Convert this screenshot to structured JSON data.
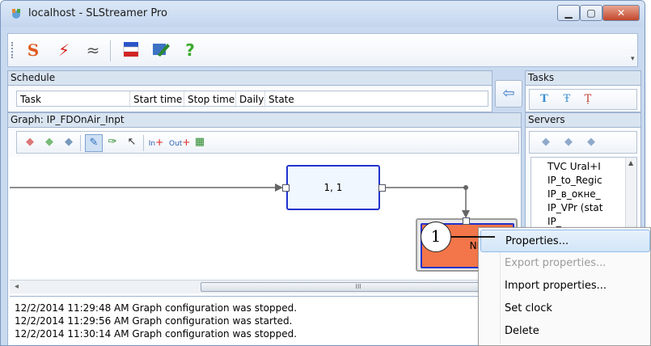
{
  "window": {
    "title": "localhost - SLStreamer Pro"
  },
  "main_toolbar": {
    "icons": [
      "s-icon",
      "lightning-icon",
      "waves-icon",
      "flags-icon",
      "edit-icon",
      "help-icon"
    ]
  },
  "schedule": {
    "header": "Schedule",
    "columns": [
      "Task",
      "Start time",
      "Stop time",
      "Daily",
      "State"
    ]
  },
  "tasks": {
    "header": "Tasks"
  },
  "graph": {
    "header": "Graph: IP_FDOnAir_Inpt",
    "node1_label": "1, 1",
    "node2_label": "NR"
  },
  "servers": {
    "header": "Servers",
    "items": [
      "TVC Ural+I",
      "IP_to_Regic",
      "IP_в_окне_",
      "IP_VPr (stat",
      "IP_"
    ]
  },
  "log": {
    "lines": [
      "12/2/2014 11:29:48 AM Graph configuration was stopped.",
      "12/2/2014 11:29:56 AM Graph configuration was started.",
      "12/2/2014 11:30:14 AM Graph configuration was stopped."
    ]
  },
  "context_menu": {
    "items": [
      {
        "label": "Properties...",
        "state": "highlighted"
      },
      {
        "label": "Export properties...",
        "state": "disabled"
      },
      {
        "label": "Import properties...",
        "state": "normal"
      },
      {
        "label": "Set clock",
        "state": "normal"
      },
      {
        "label": "Delete",
        "state": "normal"
      }
    ]
  },
  "callout": {
    "number": "1"
  },
  "scroll": {
    "thumb_glyph": "III",
    "left_arrow": "◂"
  },
  "colors": {
    "node_fill": "#f1f7ff",
    "node_border": "#2233cc",
    "node2_fill": "#f2764a",
    "accent": "#3d6fb6"
  }
}
